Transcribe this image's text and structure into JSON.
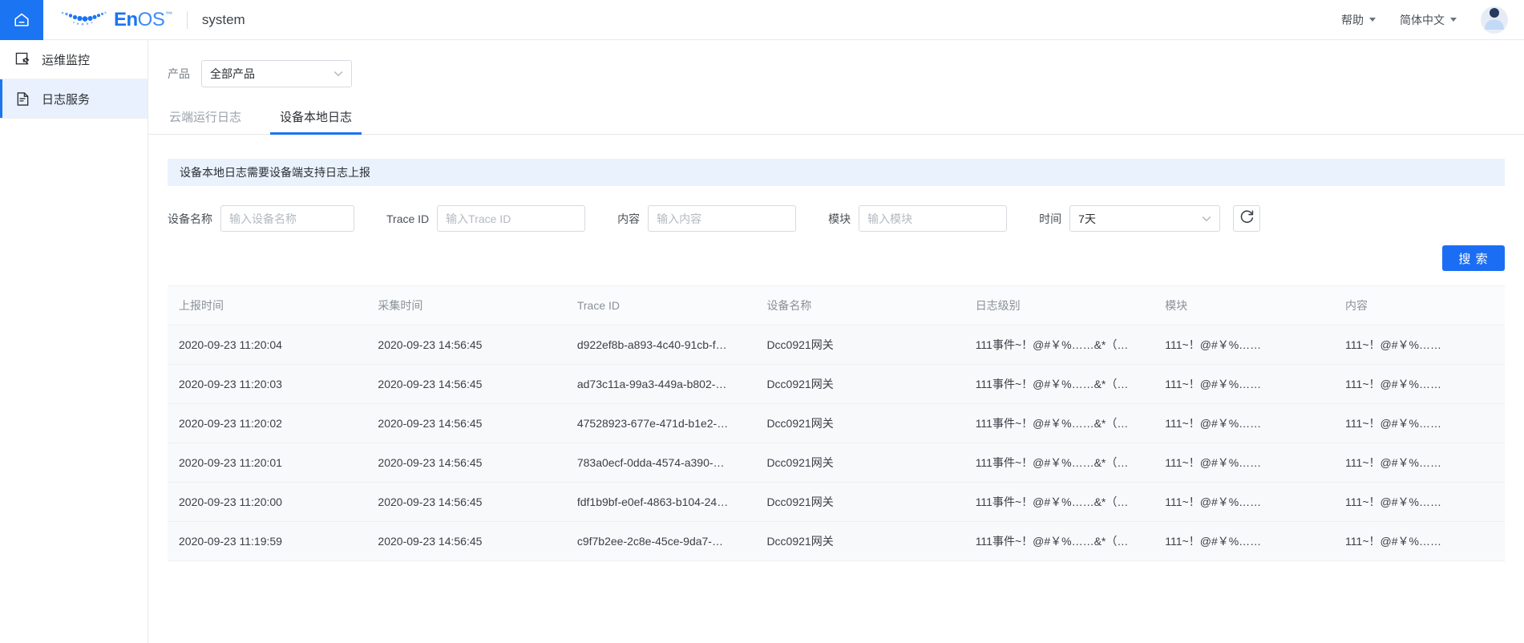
{
  "header": {
    "home_icon": "home-icon",
    "brand": {
      "en": "En",
      "os": "OS",
      "tm": "™"
    },
    "app_title": "system",
    "help_label": "帮助",
    "language_label": "简体中文",
    "avatar_icon": "user-avatar-icon"
  },
  "sidebar": {
    "items": [
      {
        "label": "运维监控",
        "icon": "ops-monitor-icon",
        "active": false
      },
      {
        "label": "日志服务",
        "icon": "log-service-icon",
        "active": true
      }
    ]
  },
  "filters": {
    "product_label": "产品",
    "product_value": "全部产品"
  },
  "tabs": [
    {
      "label": "云端运行日志",
      "active": false
    },
    {
      "label": "设备本地日志",
      "active": true
    }
  ],
  "banner": {
    "text": "设备本地日志需要设备端支持日志上报"
  },
  "search_form": {
    "device_name": {
      "label": "设备名称",
      "placeholder": "输入设备名称",
      "value": ""
    },
    "trace_id": {
      "label": "Trace ID",
      "placeholder": "输入Trace ID",
      "value": ""
    },
    "content": {
      "label": "内容",
      "placeholder": "输入内容",
      "value": ""
    },
    "module": {
      "label": "模块",
      "placeholder": "输入模块",
      "value": ""
    },
    "time": {
      "label": "时间",
      "value": "7天"
    },
    "refresh_icon": "refresh-icon",
    "search_button": "搜 索"
  },
  "table": {
    "columns": [
      "上报时间",
      "采集时间",
      "Trace ID",
      "设备名称",
      "日志级别",
      "模块",
      "内容"
    ],
    "rows": [
      {
        "report_time": "2020-09-23 11:20:04",
        "collect_time": "2020-09-23 14:56:45",
        "trace_id": "d922ef8b-a893-4c40-91cb-f…",
        "device_name": "Dcc0921网关",
        "log_level": "111事件~！@#￥%……&*（…",
        "module": "111~！@#￥%……",
        "content": "111~！@#￥%……"
      },
      {
        "report_time": "2020-09-23 11:20:03",
        "collect_time": "2020-09-23 14:56:45",
        "trace_id": "ad73c11a-99a3-449a-b802-…",
        "device_name": "Dcc0921网关",
        "log_level": "111事件~！@#￥%……&*（…",
        "module": "111~！@#￥%……",
        "content": "111~！@#￥%……"
      },
      {
        "report_time": "2020-09-23 11:20:02",
        "collect_time": "2020-09-23 14:56:45",
        "trace_id": "47528923-677e-471d-b1e2-…",
        "device_name": "Dcc0921网关",
        "log_level": "111事件~！@#￥%……&*（…",
        "module": "111~！@#￥%……",
        "content": "111~！@#￥%……"
      },
      {
        "report_time": "2020-09-23 11:20:01",
        "collect_time": "2020-09-23 14:56:45",
        "trace_id": "783a0ecf-0dda-4574-a390-…",
        "device_name": "Dcc0921网关",
        "log_level": "111事件~！@#￥%……&*（…",
        "module": "111~！@#￥%……",
        "content": "111~！@#￥%……"
      },
      {
        "report_time": "2020-09-23 11:20:00",
        "collect_time": "2020-09-23 14:56:45",
        "trace_id": "fdf1b9bf-e0ef-4863-b104-24…",
        "device_name": "Dcc0921网关",
        "log_level": "111事件~！@#￥%……&*（…",
        "module": "111~！@#￥%……",
        "content": "111~！@#￥%……"
      },
      {
        "report_time": "2020-09-23 11:19:59",
        "collect_time": "2020-09-23 14:56:45",
        "trace_id": "c9f7b2ee-2c8e-45ce-9da7-…",
        "device_name": "Dcc0921网关",
        "log_level": "111事件~！@#￥%……&*（…",
        "module": "111~！@#￥%……",
        "content": "111~！@#￥%……"
      }
    ]
  },
  "colors": {
    "accent": "#1b74f2",
    "accent_button": "#1b6ef3",
    "banner_bg": "#eaf2fd",
    "sidebar_active_bg": "#e9f1fe",
    "table_row_bg": "#f8f9fb"
  }
}
